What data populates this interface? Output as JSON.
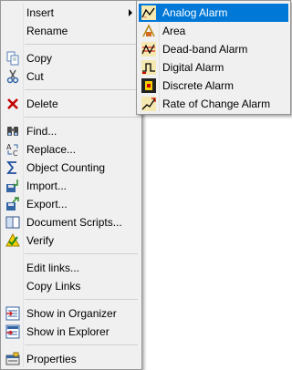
{
  "main_menu": {
    "insert": "Insert",
    "rename": "Rename",
    "copy": "Copy",
    "cut": "Cut",
    "delete": "Delete",
    "find": "Find...",
    "replace": "Replace...",
    "object_counting": "Object Counting",
    "import": "Import...",
    "export": "Export...",
    "document_scripts": "Document Scripts...",
    "verify": "Verify",
    "edit_links": "Edit links...",
    "copy_links": "Copy Links",
    "show_in_organizer": "Show in Organizer",
    "show_in_explorer": "Show in Explorer",
    "properties": "Properties"
  },
  "submenu": {
    "analog_alarm": "Analog Alarm",
    "area": "Area",
    "deadband_alarm": "Dead-band Alarm",
    "digital_alarm": "Digital Alarm",
    "discrete_alarm": "Discrete Alarm",
    "rate_of_change_alarm": "Rate of Change Alarm"
  },
  "colors": {
    "highlight": "#0078d7",
    "menu_bg": "#f0f0f0"
  }
}
